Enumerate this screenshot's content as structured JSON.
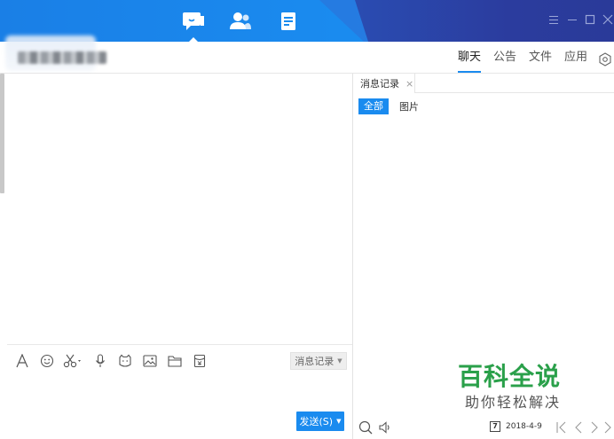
{
  "titlebar": {
    "tabs": [
      {
        "icon": "chat-bubble-icon",
        "active": true
      },
      {
        "icon": "contacts-icon",
        "active": false
      },
      {
        "icon": "document-icon",
        "active": false
      }
    ],
    "controls": [
      "menu-icon",
      "minimize-icon",
      "maximize-icon",
      "close-icon"
    ],
    "colors": {
      "blue": "#1a8bef",
      "dark": "#2b3c9e"
    }
  },
  "right_tabs": [
    {
      "label": "聊天",
      "active": true
    },
    {
      "label": "公告",
      "active": false
    },
    {
      "label": "文件",
      "active": false
    },
    {
      "label": "应用",
      "active": false
    }
  ],
  "toolbar": {
    "tools": [
      "font-icon",
      "emoji-icon",
      "screenshot-scissors-icon",
      "microphone-icon",
      "sticker-icon",
      "image-icon",
      "folder-icon",
      "red-packet-icon"
    ],
    "message_record_label": "消息记录"
  },
  "send": {
    "label": "发送(S)"
  },
  "history_panel": {
    "tab_label": "消息记录",
    "filters": {
      "all": "全部",
      "images": "图片"
    },
    "date": "2018-4-9"
  },
  "watermark": {
    "title": "百科全说",
    "subtitle": "助你轻松解决"
  }
}
